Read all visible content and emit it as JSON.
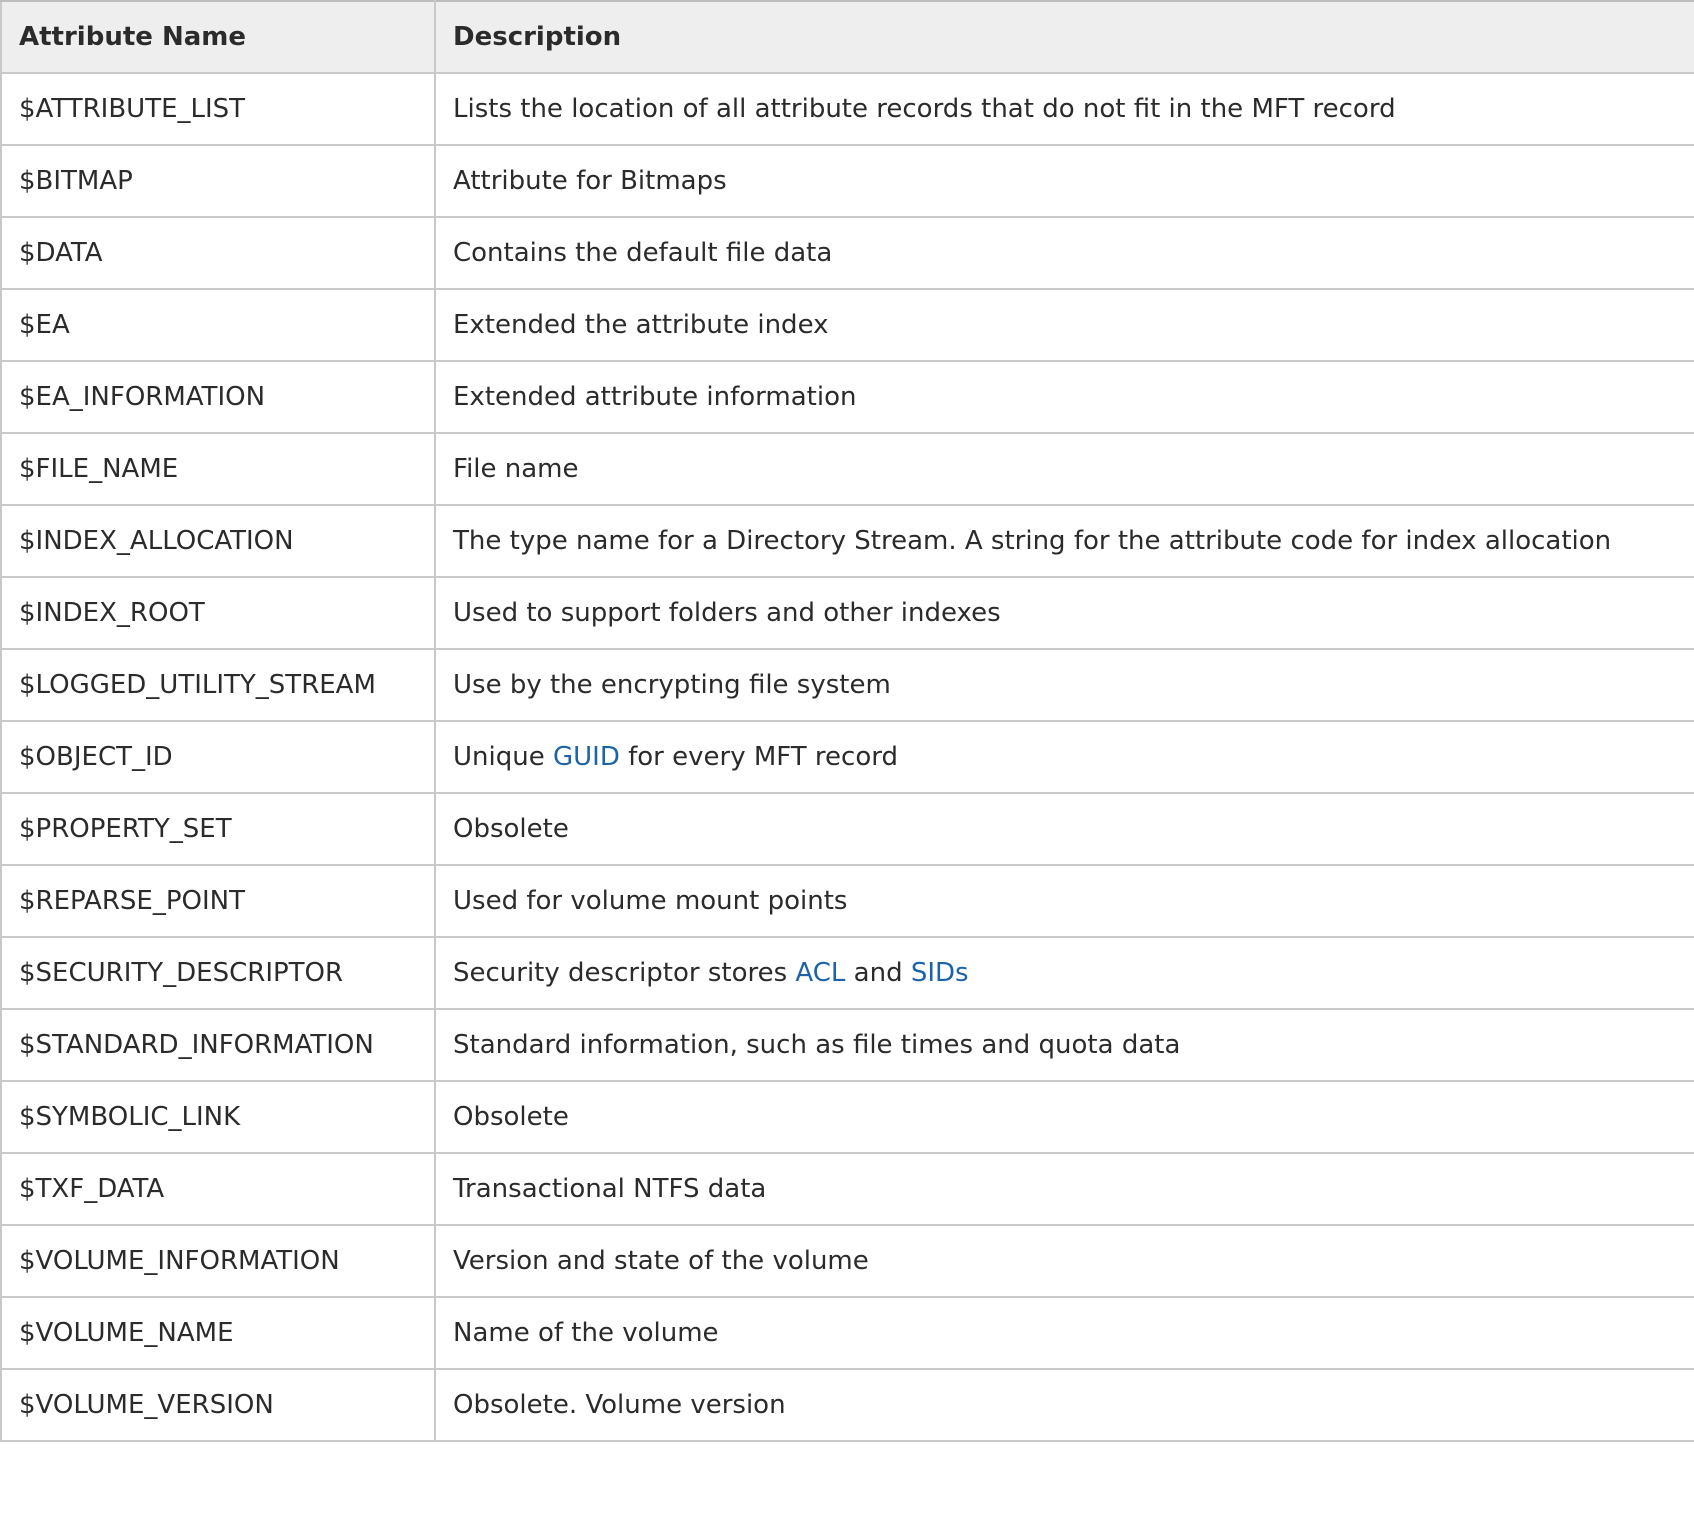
{
  "table": {
    "headers": [
      "Attribute Name",
      "Description"
    ],
    "rows": [
      {
        "name": "$ATTRIBUTE_LIST",
        "desc": [
          {
            "text": "Lists the location of all attribute records that do not fit in the MFT record"
          }
        ]
      },
      {
        "name": "$BITMAP",
        "desc": [
          {
            "text": "Attribute for Bitmaps"
          }
        ]
      },
      {
        "name": "$DATA",
        "desc": [
          {
            "text": "Contains the default file data"
          }
        ]
      },
      {
        "name": "$EA",
        "desc": [
          {
            "text": "Extended the attribute index"
          }
        ]
      },
      {
        "name": "$EA_INFORMATION",
        "desc": [
          {
            "text": "Extended attribute information"
          }
        ]
      },
      {
        "name": "$FILE_NAME",
        "desc": [
          {
            "text": "File name"
          }
        ]
      },
      {
        "name": "$INDEX_ALLOCATION",
        "desc": [
          {
            "text": "The type name for a Directory Stream. A string for the attribute code for index allocation"
          }
        ]
      },
      {
        "name": "$INDEX_ROOT",
        "desc": [
          {
            "text": "Used to support folders and other indexes"
          }
        ]
      },
      {
        "name": "$LOGGED_UTILITY_STREAM",
        "desc": [
          {
            "text": "Use by the encrypting file system"
          }
        ]
      },
      {
        "name": "$OBJECT_ID",
        "desc": [
          {
            "text": "Unique "
          },
          {
            "text": "GUID",
            "link": true
          },
          {
            "text": " for every MFT record"
          }
        ]
      },
      {
        "name": "$PROPERTY_SET",
        "desc": [
          {
            "text": "Obsolete"
          }
        ]
      },
      {
        "name": "$REPARSE_POINT",
        "desc": [
          {
            "text": "Used for volume mount points"
          }
        ]
      },
      {
        "name": "$SECURITY_DESCRIPTOR",
        "desc": [
          {
            "text": "Security descriptor stores "
          },
          {
            "text": "ACL",
            "link": true
          },
          {
            "text": " and "
          },
          {
            "text": "SIDs",
            "link": true
          }
        ]
      },
      {
        "name": "$STANDARD_INFORMATION",
        "desc": [
          {
            "text": "Standard information, such as file times and quota data"
          }
        ]
      },
      {
        "name": "$SYMBOLIC_LINK",
        "desc": [
          {
            "text": "Obsolete"
          }
        ]
      },
      {
        "name": "$TXF_DATA",
        "desc": [
          {
            "text": "Transactional NTFS data"
          }
        ]
      },
      {
        "name": "$VOLUME_INFORMATION",
        "desc": [
          {
            "text": "Version and state of the volume"
          }
        ]
      },
      {
        "name": "$VOLUME_NAME",
        "desc": [
          {
            "text": "Name of the volume"
          }
        ]
      },
      {
        "name": "$VOLUME_VERSION",
        "desc": [
          {
            "text": "Obsolete. Volume version"
          }
        ]
      }
    ]
  },
  "colors": {
    "link": "#1d63a8",
    "header_bg": "#eeeeee",
    "border": "#c9c9c9",
    "text": "#2b2b2b"
  }
}
